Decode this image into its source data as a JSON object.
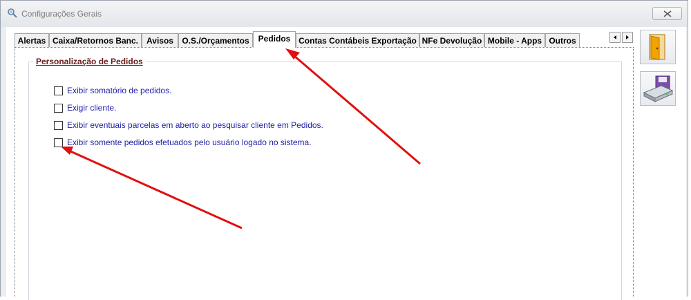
{
  "window": {
    "title": "Configurações Gerais"
  },
  "tabs": [
    {
      "label": "Alertas"
    },
    {
      "label": "Caixa/Retornos Banc."
    },
    {
      "label": "Avisos"
    },
    {
      "label": "O.S./Orçamentos"
    },
    {
      "label": "Pedidos",
      "active": true
    },
    {
      "label": "Contas Contábeis Exportação"
    },
    {
      "label": "NFe Devolução"
    },
    {
      "label": "Mobile - Apps"
    },
    {
      "label": "Outros"
    }
  ],
  "group": {
    "title": "Personalização de Pedidos",
    "options": [
      {
        "label": "Exibir somatório de pedidos.",
        "checked": false
      },
      {
        "label": "Exigir cliente.",
        "checked": false
      },
      {
        "label": "Exibir eventuais parcelas em aberto ao pesquisar cliente em Pedidos.",
        "checked": false
      },
      {
        "label": "Exibir somente pedidos efetuados pelo usuário logado no sistema.",
        "checked": false
      }
    ]
  },
  "colors": {
    "annotation_arrow": "#e01010",
    "option_text": "#2020a8",
    "group_title": "#6b1a1a"
  },
  "icons": {
    "close": "close-icon",
    "exit": "exit-door-icon",
    "save": "save-disk-icon",
    "app": "app-settings-icon"
  }
}
